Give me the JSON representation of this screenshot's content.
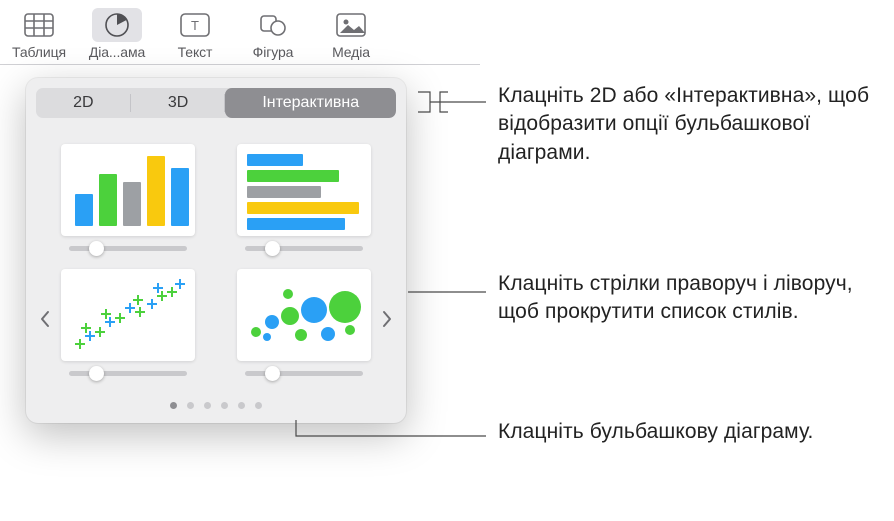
{
  "toolbar": {
    "table": "Таблиця",
    "chart": "Діа...ама",
    "text": "Текст",
    "shape": "Фігура",
    "media": "Медіа"
  },
  "seg": {
    "d2": "2D",
    "d3": "3D",
    "interactive": "Інтерактивна"
  },
  "callouts": {
    "top": "Клацніть 2D або «Інтерактивна», щоб відобразити опції бульбашкової діаграми.",
    "mid": "Клацніть стрілки праворуч і ліворуч, щоб прокрутити список стилів.",
    "bot": "Клацніть бульбашкову діаграму."
  },
  "colors": {
    "blue": "#2aa0f5",
    "green": "#4cd13c",
    "gray": "#9da0a4",
    "yellow": "#f9c90e"
  }
}
